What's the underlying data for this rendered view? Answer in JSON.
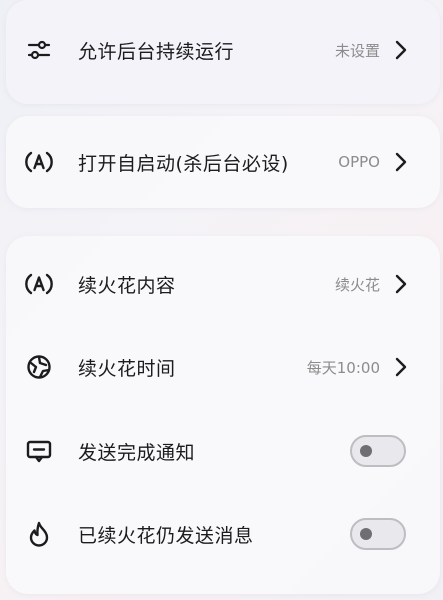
{
  "background_run": {
    "label": "允许后台持续运行",
    "value": "未设置"
  },
  "autostart": {
    "label": "打开自启动(杀后台必设)",
    "value": "OPPO"
  },
  "settings": {
    "content": {
      "label": "续火花内容",
      "value": "续火花"
    },
    "time": {
      "label": "续火花时间",
      "value": "每天10:00"
    },
    "notify": {
      "label": "发送完成通知",
      "enabled": false
    },
    "still_send": {
      "label": "已续火花仍发送消息",
      "enabled": false
    }
  },
  "colors": {
    "text": "#1c1c1c",
    "value_text": "#8c8c8c",
    "toggle_off_track": "#e9e9ed",
    "toggle_off_knob": "#6e6e73"
  },
  "icons": {
    "background_run": "sliders-icon",
    "autostart": "auto-a-icon",
    "content": "auto-a-icon",
    "time": "clock-icon",
    "notify": "message-icon",
    "still_send": "flame-icon"
  }
}
